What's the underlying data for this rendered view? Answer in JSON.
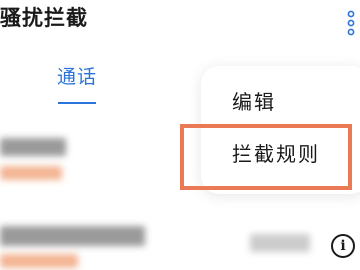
{
  "app": {
    "title": "骚扰拦截"
  },
  "tabs": [
    {
      "label": "通话",
      "active": true
    }
  ],
  "menu": {
    "items": [
      {
        "label": "编辑"
      },
      {
        "label": "拦截规则"
      }
    ]
  },
  "icons": {
    "more": "more-vertical-icon",
    "info": "info-icon"
  },
  "colors": {
    "accent": "#2b74d9",
    "highlight": "#e97a55"
  }
}
